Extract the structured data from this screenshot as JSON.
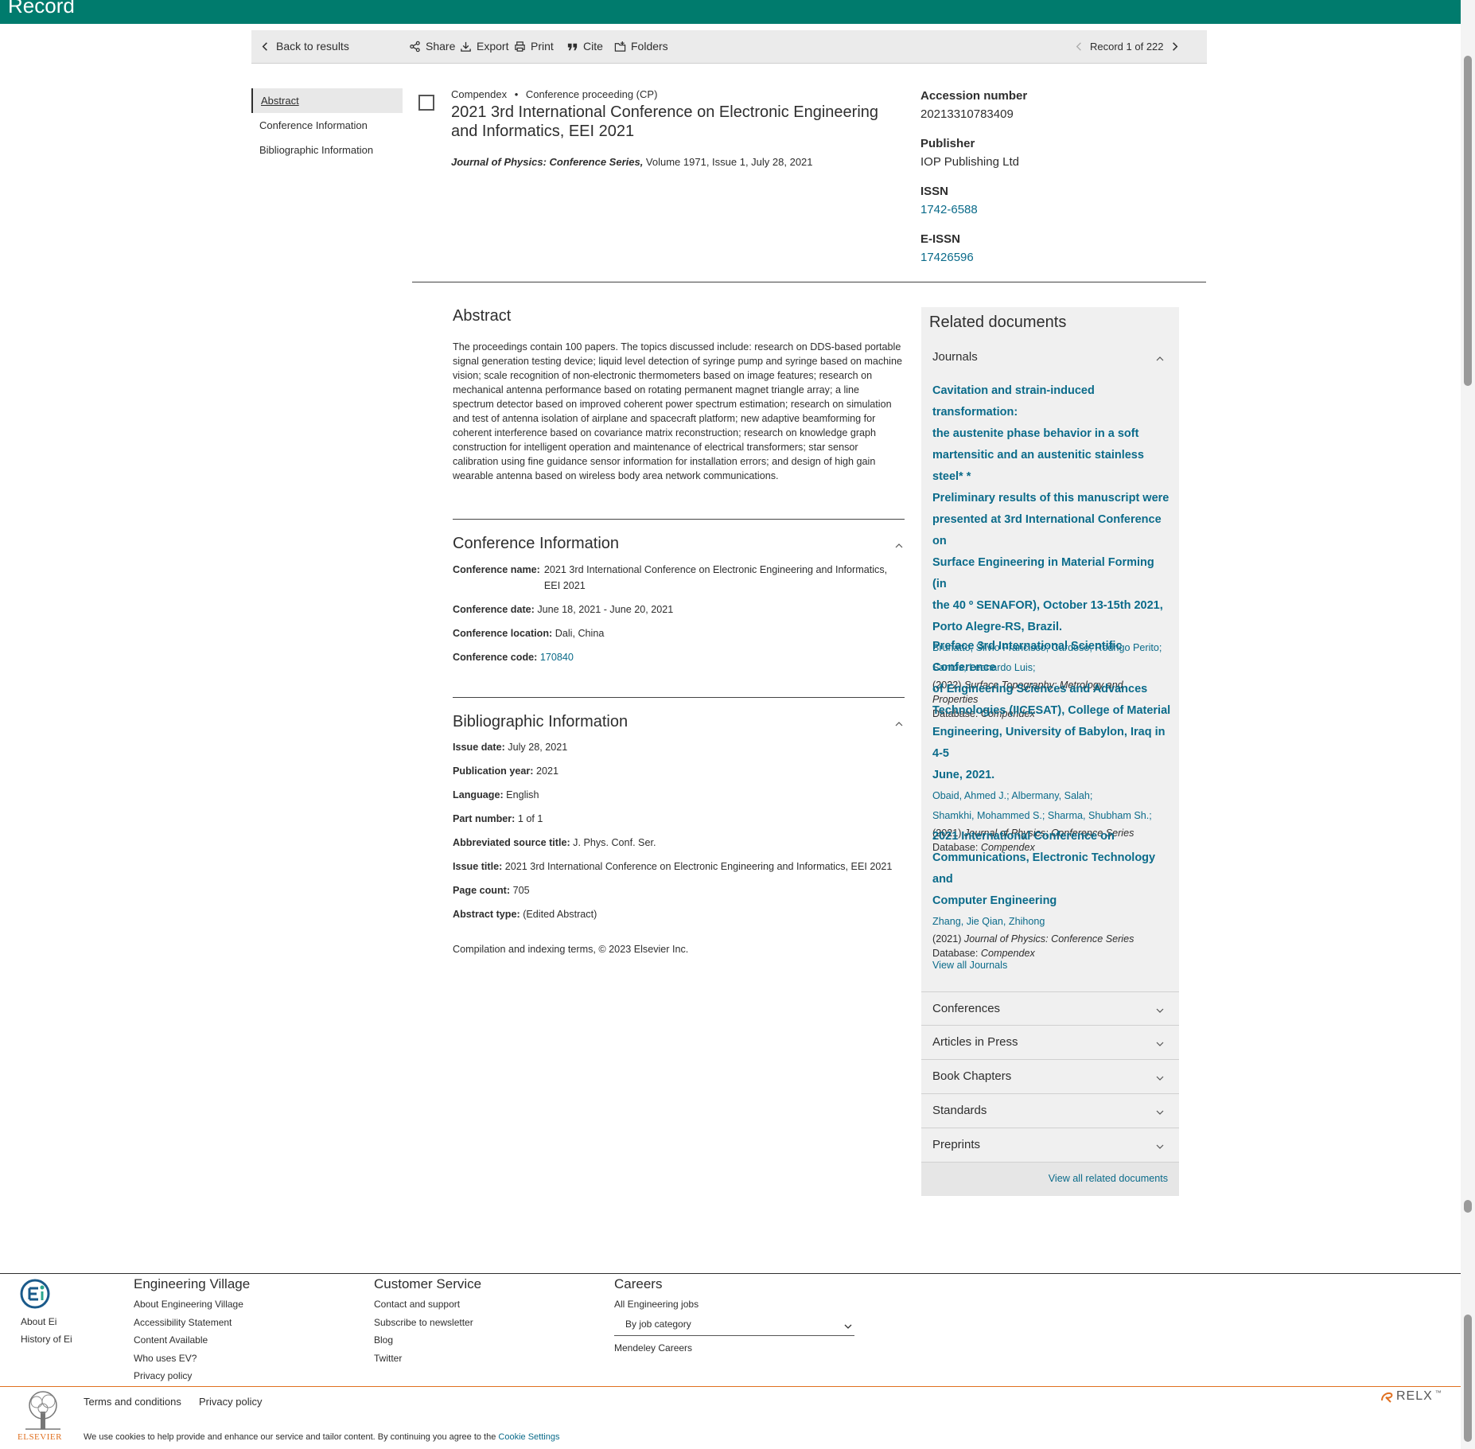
{
  "header": {
    "title": "Record"
  },
  "toolbar": {
    "back": "Back to results",
    "share": "Share",
    "export": "Export",
    "print": "Print",
    "cite": "Cite",
    "folders": "Folders",
    "record_position": "Record 1 of 222"
  },
  "left_nav": {
    "items": [
      {
        "label": "Abstract"
      },
      {
        "label": "Conference Information"
      },
      {
        "label": "Bibliographic Information"
      }
    ]
  },
  "document": {
    "database": "Compendex",
    "doc_type": "Conference proceeding (CP)",
    "title": "2021 3rd International Conference on Electronic Engineering and Informatics, EEI 2021",
    "source_title": "Journal of Physics: Conference Series,",
    "source_rest": " Volume 1971, Issue 1, July 28, 2021"
  },
  "meta": {
    "accession_label": "Accession number",
    "accession_value": "20213310783409",
    "publisher_label": "Publisher",
    "publisher_value": "IOP Publishing Ltd",
    "issn_label": "ISSN",
    "issn_value": "1742-6588",
    "eissn_label": "E-ISSN",
    "eissn_value": "17426596"
  },
  "abstract": {
    "heading": "Abstract",
    "body": "The proceedings contain 100 papers. The topics discussed include: research on DDS-based portable signal generation testing device; liquid level detection of syringe pump and syringe based on machine vision; scale recognition of non-electronic thermometers based on image features; research on mechanical antenna performance based on rotating permanent magnet triangle array; a line spectrum detector based on improved coherent power spectrum estimation; research on simulation and test of antenna isolation of airplane and spacecraft platform; new adaptive beamforming for coherent interference based on covariance matrix reconstruction; research on knowledge graph construction for intelligent operation and maintenance of electrical transformers; star sensor calibration using fine guidance sensor information for installation errors; and design of high gain wearable antenna based on wireless body area network communications."
  },
  "conference": {
    "heading": "Conference Information",
    "name_label": "Conference name:",
    "name_value": "2021 3rd International Conference on Electronic Engineering and Informatics, EEI 2021",
    "date_label": "Conference date:",
    "date_value": "June 18, 2021 - June 20, 2021",
    "location_label": "Conference location:",
    "location_value": "Dali, China",
    "code_label": "Conference code:",
    "code_value": "170840"
  },
  "biblio": {
    "heading": "Bibliographic Information",
    "fields": [
      {
        "label": "Issue date:",
        "value": "July 28, 2021"
      },
      {
        "label": "Publication year:",
        "value": "2021"
      },
      {
        "label": "Language:",
        "value": "English"
      },
      {
        "label": "Part number:",
        "value": "1 of 1"
      },
      {
        "label": "Abbreviated source title:",
        "value": "J. Phys. Conf. Ser."
      },
      {
        "label": "Issue title:",
        "value": "2021 3rd International Conference on Electronic Engineering and Informatics, EEI 2021"
      },
      {
        "label": "Page count:",
        "value": "705"
      },
      {
        "label": "Abstract type:",
        "value": "(Edited Abstract)"
      }
    ],
    "copyright": "Compilation and indexing terms, © 2023 Elsevier Inc."
  },
  "related": {
    "heading": "Related documents",
    "journals_label": "Journals",
    "docs": [
      {
        "title_lines": [
          "Cavitation and strain-induced transformation:",
          "the austenite phase behavior in a soft",
          "martensitic and an austenitic stainless steel* *",
          "Preliminary results of this manuscript were",
          "presented at 3rd International Conference on",
          "Surface Engineering in Material Forming (in",
          "the 40 º SENAFOR), October 13-15th 2021,",
          "Porto Alegre-RS, Brazil."
        ],
        "authors_lines": [
          "Brunatto, Silvio Francisco; Cardoso, Rodrigo Perito;",
          "Santos, Leonardo Luis;"
        ],
        "year": "(2022) ",
        "source": "Surface Topography: Metrology and Properties",
        "db_label": "Database: ",
        "db": "Compendex"
      },
      {
        "title_lines": [
          "Preface 3rd International Scientific Conference",
          "of Engineering Sciences and Advances",
          "Technologies (IICESAT), College of Material",
          "Engineering, University of Babylon, Iraq in 4-5",
          "June, 2021."
        ],
        "authors_lines": [
          "Obaid, Ahmed J.; Albermany, Salah;",
          "Shamkhi, Mohammed S.; Sharma, Shubham Sh.;"
        ],
        "year": "(2021) ",
        "source": "Journal of Physics: Conference Series",
        "db_label": "Database: ",
        "db": "Compendex"
      },
      {
        "title_lines": [
          "2021 International Conference on",
          "Communications, Electronic Technology and",
          "Computer Engineering"
        ],
        "authors_lines": [
          "Zhang, Jie Qian, Zhihong"
        ],
        "year": "(2021) ",
        "source": "Journal of Physics: Conference Series",
        "db_label": "Database: ",
        "db": "Compendex"
      }
    ],
    "view_all_journals": "View all Journals",
    "sections": [
      {
        "label": "Conferences"
      },
      {
        "label": "Articles in Press"
      },
      {
        "label": "Book Chapters"
      },
      {
        "label": "Standards"
      },
      {
        "label": "Preprints"
      }
    ],
    "view_all": "View all related documents"
  },
  "footer": {
    "about_ei": "About Ei",
    "history_ei": "History of Ei",
    "ev_heading": "Engineering Village",
    "ev_links": [
      "About Engineering Village",
      "Accessibility Statement",
      "Content Available",
      "Who uses EV?",
      "Privacy policy"
    ],
    "cs_heading": "Customer Service",
    "cs_links": [
      "Contact and support",
      "Subscribe to newsletter",
      "Blog",
      "Twitter"
    ],
    "careers_heading": "Careers",
    "careers_all": "All Engineering jobs",
    "careers_select": "By job category",
    "careers_mendeley": "Mendeley Careers",
    "terms": "Terms and conditions",
    "privacy": "Privacy policy",
    "elsevier": "ELSEVIER",
    "relx": "RELX",
    "cookie_text": "We use cookies to help provide and enhance our service and tailor content. By continuing you agree to the ",
    "cookie_link": "Cookie Settings"
  },
  "colors": {
    "header": "#007b6d",
    "link": "#0b6b8a",
    "accent_line": "#e07020"
  }
}
